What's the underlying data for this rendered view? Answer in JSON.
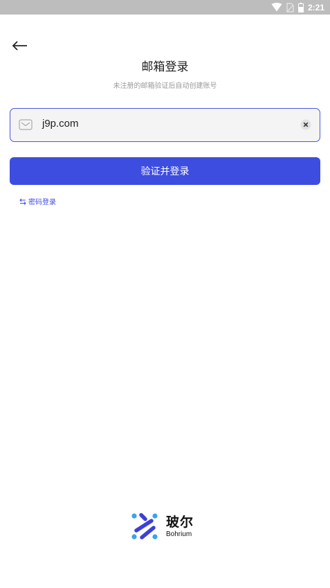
{
  "status_bar": {
    "time": "2:21",
    "icons": [
      "wifi-icon",
      "no-sim-icon",
      "battery-icon"
    ]
  },
  "header": {
    "title": "邮箱登录",
    "subtitle": "未注册的邮箱验证后自动创建账号"
  },
  "email_field": {
    "value": "j9p.com",
    "icon": "mail-icon",
    "clear_icon": "clear-icon"
  },
  "submit_button": {
    "label": "验证并登录"
  },
  "password_login": {
    "icon": "swap-icon",
    "label": "密码登录"
  },
  "logo": {
    "name_cn": "玻尔",
    "name_en": "Bohrium"
  },
  "colors": {
    "accent": "#3d4de0",
    "status_bar": "#bdbdbd",
    "input_bg": "#f4f4f4",
    "logo_light_blue": "#3aa3f0",
    "logo_dark_blue": "#3d3fd8"
  }
}
